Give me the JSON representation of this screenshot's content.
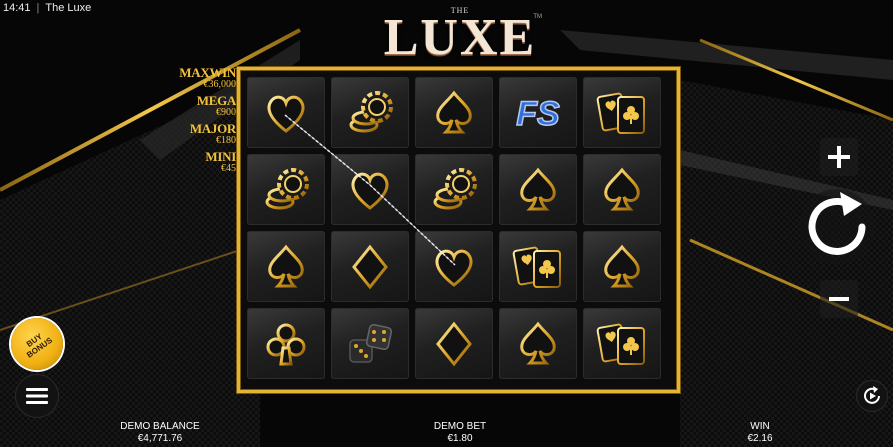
{
  "status_bar": {
    "time": "14:41",
    "app_title": "The Luxe"
  },
  "logo": {
    "small": "THE",
    "main": "LUXE",
    "tm": "TM"
  },
  "jackpots": [
    {
      "name": "MAXWIN",
      "value": "€36,000"
    },
    {
      "name": "MEGA",
      "value": "€900"
    },
    {
      "name": "MAJOR",
      "value": "€180"
    },
    {
      "name": "MINI",
      "value": "€45"
    }
  ],
  "reels": {
    "rows": [
      [
        "heart",
        "chips",
        "spade",
        "free-spins",
        "aces"
      ],
      [
        "chips",
        "heart",
        "chips",
        "spade",
        "spade"
      ],
      [
        "spade",
        "diamond",
        "heart",
        "aces",
        "spade"
      ],
      [
        "club",
        "dice",
        "diamond",
        "spade",
        "aces"
      ]
    ],
    "free_spins_label": "FS"
  },
  "controls": {
    "buy_bonus_label": "BUY BONUS",
    "plus_label": "+",
    "minus_label": "−"
  },
  "footer": {
    "balance_label": "DEMO BALANCE",
    "balance_value": "€4,771.76",
    "bet_label": "DEMO BET",
    "bet_value": "€1.80",
    "win_label": "WIN",
    "win_value": "€2.16"
  },
  "colors": {
    "gold": "#e4b434",
    "jackpot_text": "#f4c23a",
    "free_spins_blue": "#2e6fe0"
  }
}
